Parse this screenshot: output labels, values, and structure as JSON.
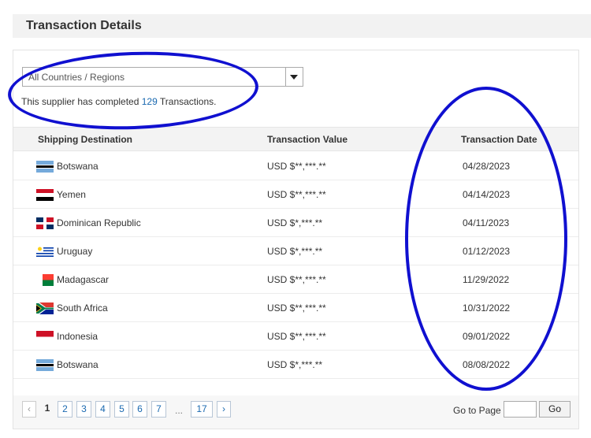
{
  "header": {
    "title": "Transaction Details"
  },
  "filter": {
    "selected": "All Countries / Regions"
  },
  "summary": {
    "prefix": "This supplier has completed ",
    "count": "129",
    "suffix": " Transactions."
  },
  "table": {
    "headers": {
      "destination": "Shipping Destination",
      "value": "Transaction Value",
      "date": "Transaction Date"
    },
    "rows": [
      {
        "country": "Botswana",
        "flag": "botswana-flag-icon",
        "value": "USD $**,***.**",
        "date": "04/28/2023"
      },
      {
        "country": "Yemen",
        "flag": "yemen-flag-icon",
        "value": "USD $**,***.**",
        "date": "04/14/2023"
      },
      {
        "country": "Dominican Republic",
        "flag": "dominican-republic-flag-icon",
        "value": "USD $*,***.**",
        "date": "04/11/2023"
      },
      {
        "country": "Uruguay",
        "flag": "uruguay-flag-icon",
        "value": "USD $*,***.**",
        "date": "01/12/2023"
      },
      {
        "country": "Madagascar",
        "flag": "madagascar-flag-icon",
        "value": "USD $**,***.**",
        "date": "11/29/2022"
      },
      {
        "country": "South Africa",
        "flag": "south-africa-flag-icon",
        "value": "USD $**,***.**",
        "date": "10/31/2022"
      },
      {
        "country": "Indonesia",
        "flag": "indonesia-flag-icon",
        "value": "USD $**,***.**",
        "date": "09/01/2022"
      },
      {
        "country": "Botswana",
        "flag": "botswana-flag-icon",
        "value": "USD $*,***.**",
        "date": "08/08/2022"
      }
    ]
  },
  "pagination": {
    "prev": "‹",
    "current": "1",
    "pages": [
      "2",
      "3",
      "4",
      "5",
      "6",
      "7"
    ],
    "ellipsis": "...",
    "last": "17",
    "next": "›",
    "goto_label": "Go to Page",
    "go_button": "Go"
  },
  "colors": {
    "annotation": "#1010d0",
    "link": "#1a69b0"
  }
}
